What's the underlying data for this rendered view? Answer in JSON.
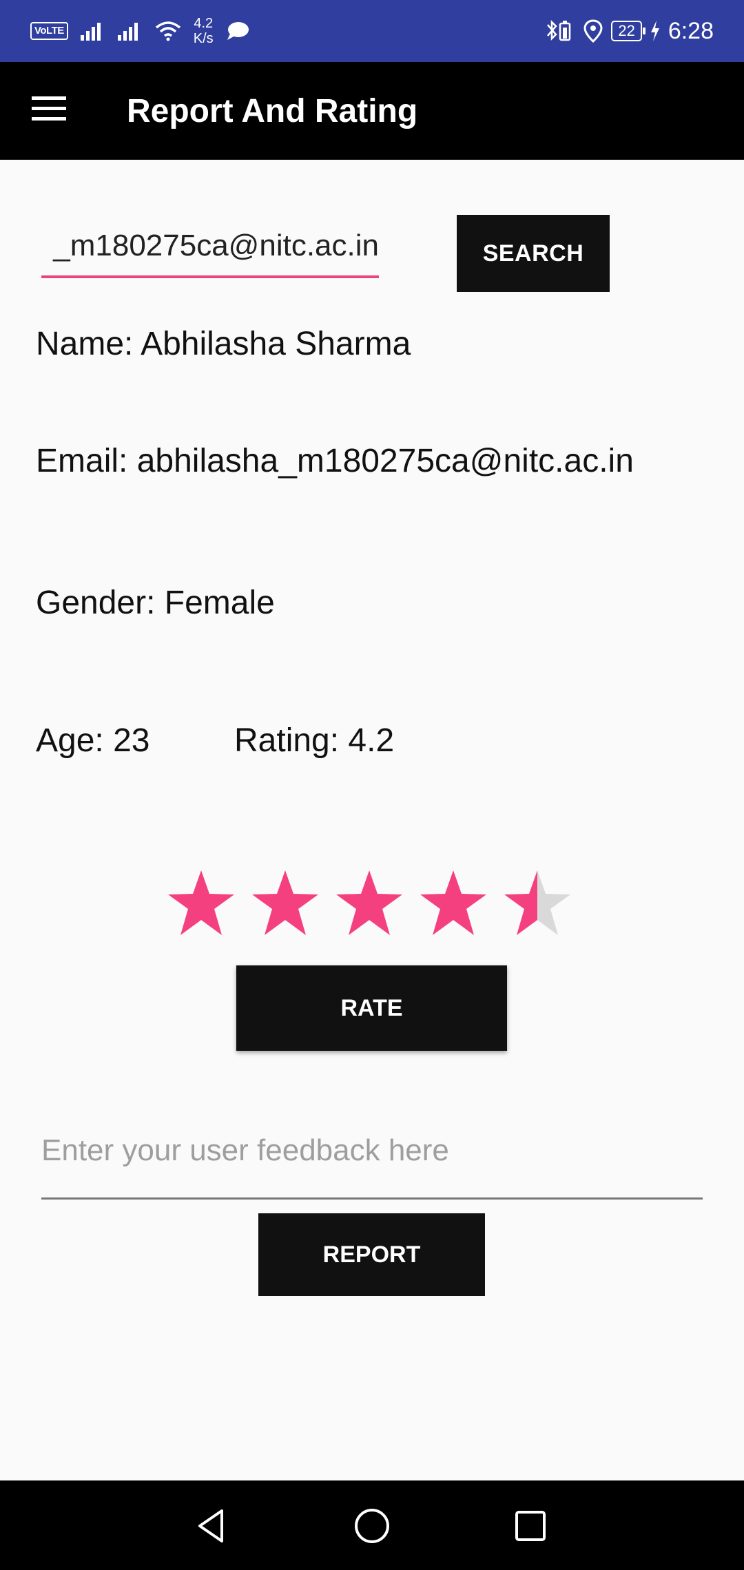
{
  "status_bar": {
    "volte": "VoLTE",
    "speed_value": "4.2",
    "speed_unit": "K/s",
    "battery": "22",
    "time": "6:28"
  },
  "app_bar": {
    "title": "Report And Rating"
  },
  "search": {
    "value": "_m180275ca@nitc.ac.in",
    "button_label": "SEARCH"
  },
  "profile": {
    "name": "Name: Abhilasha Sharma",
    "email": "Email: abhilasha_m180275ca@nitc.ac.in",
    "gender": "Gender: Female",
    "age": "Age: 23",
    "rating": "Rating: 4.2"
  },
  "rating_bar": {
    "max_stars": 5,
    "value": 4.5,
    "filled_color": "#f5407f",
    "empty_color": "#d9d9d9"
  },
  "rate_button": "RATE",
  "feedback": {
    "placeholder": "Enter your user feedback here",
    "value": ""
  },
  "report_button": "REPORT",
  "colors": {
    "status_bar": "#303f9f",
    "app_bar": "#000000",
    "accent": "#e8457d",
    "button": "#111111"
  }
}
